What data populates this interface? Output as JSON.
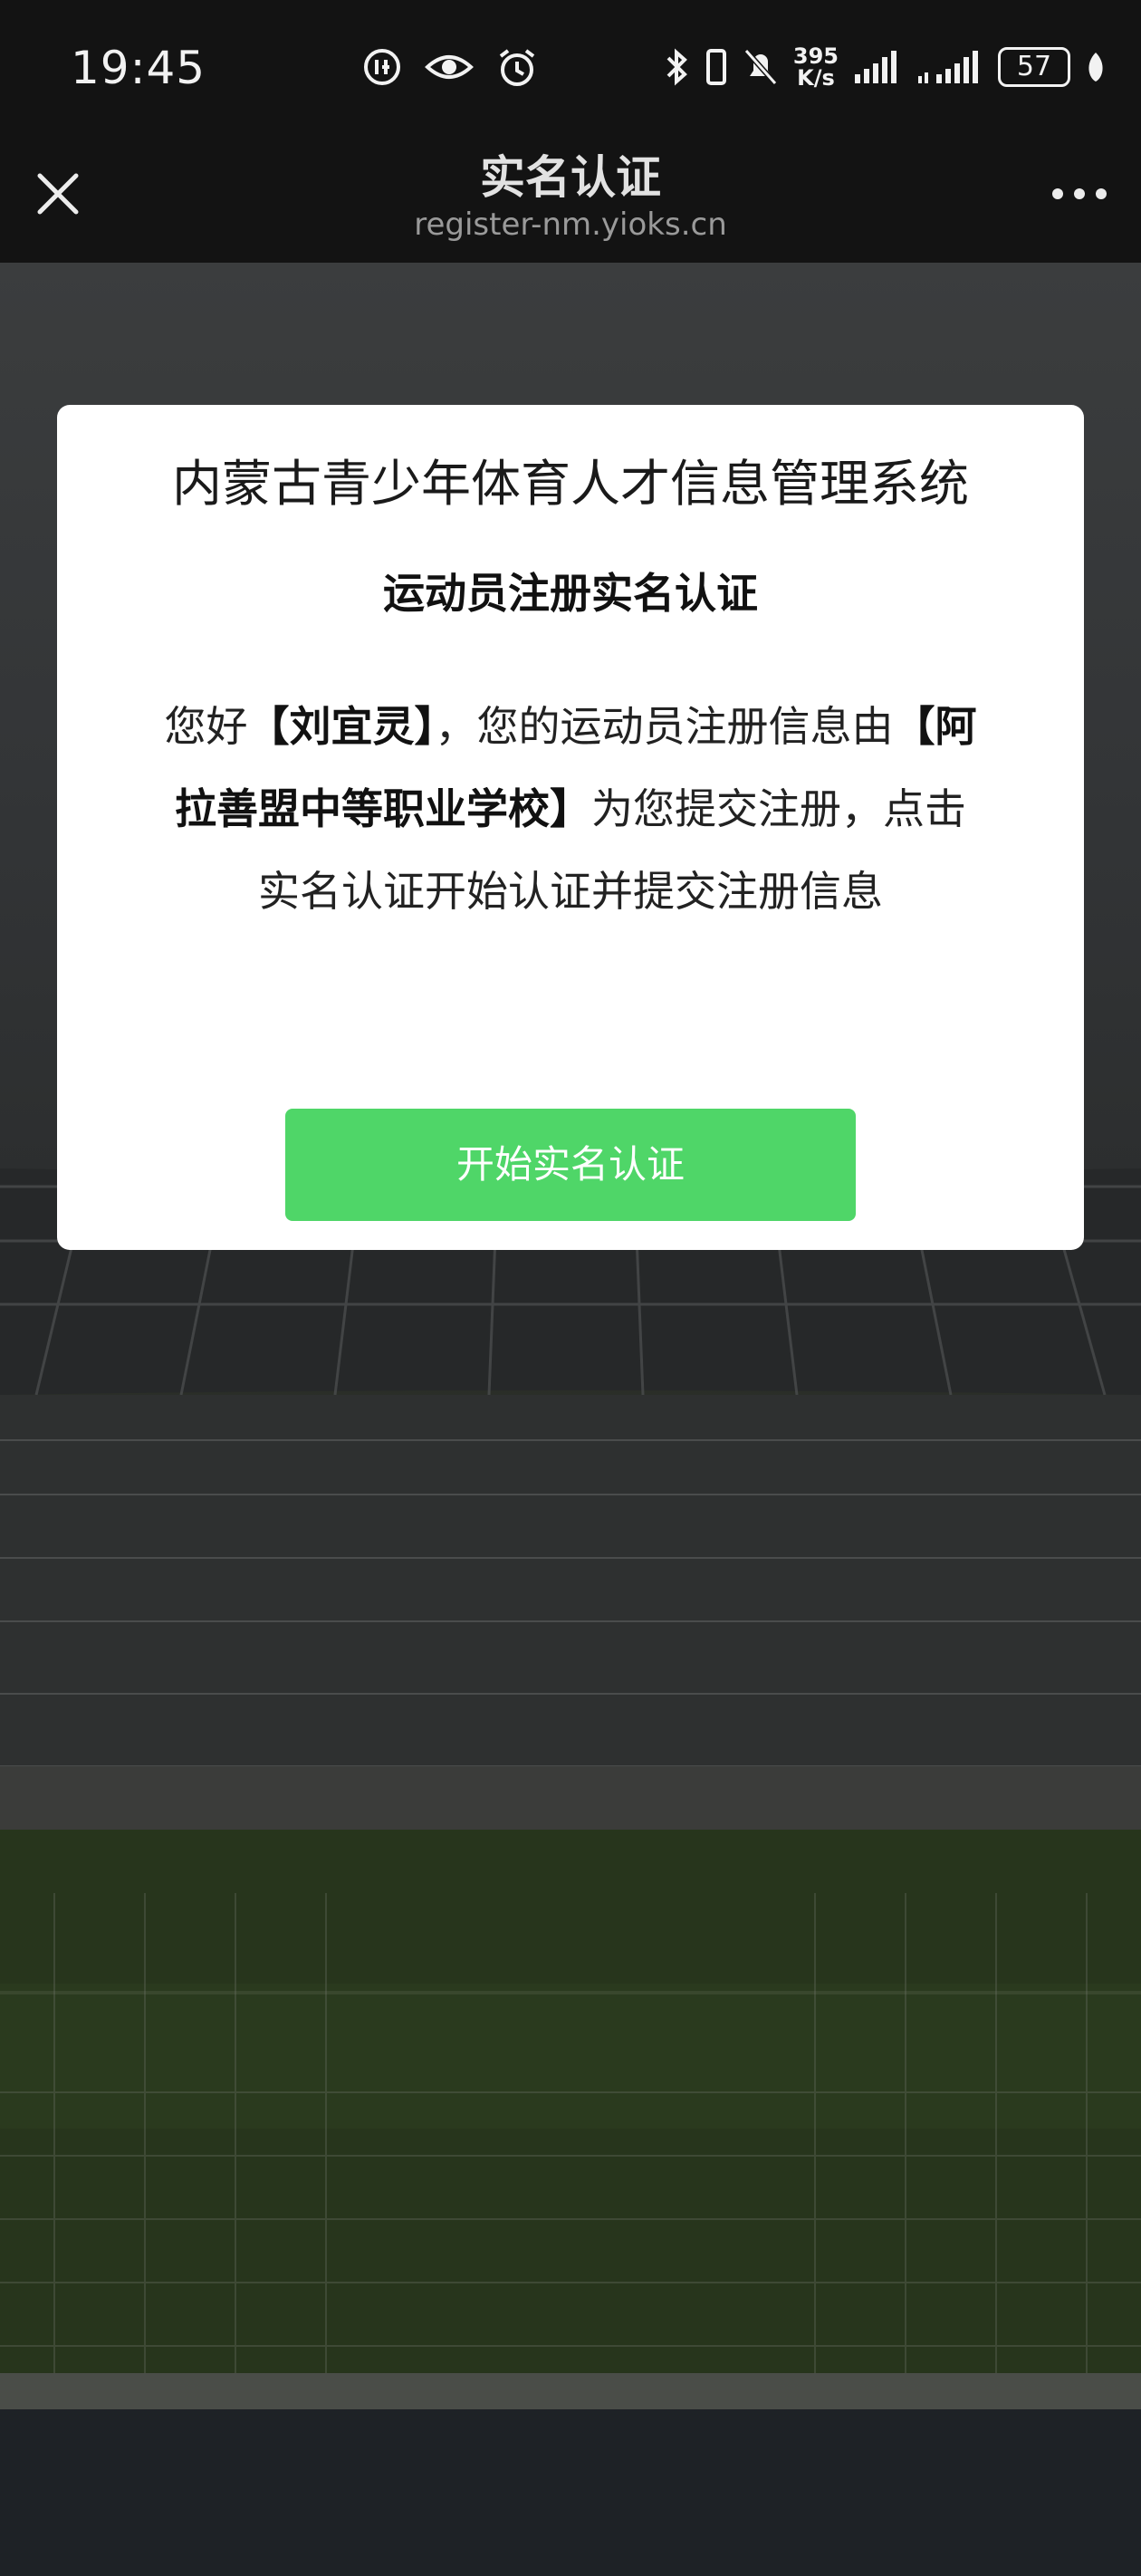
{
  "status_bar": {
    "time": "19:45",
    "net_speed_value": "395",
    "net_speed_unit": "K/s",
    "battery": "57",
    "icons": [
      "hd-icon",
      "eye-icon",
      "alarm-icon",
      "bluetooth-icon",
      "vibrate-icon",
      "mute-icon",
      "signal-icon",
      "signal-icon-2",
      "leaf-icon"
    ]
  },
  "nav": {
    "title": "实名认证",
    "url": "register-nm.yioks.cn",
    "close_icon": "close-icon",
    "more_icon": "more-icon"
  },
  "modal": {
    "system_name": "内蒙古青少年体育人才信息管理系统",
    "heading": "运动员注册实名认证",
    "greeting": "您好",
    "athlete_name": "【刘宜灵】",
    "msg_1": "，您的运动员注册信息由",
    "school": "【阿拉善盟中等职业学校】",
    "msg_2": "为您提交注册，点击实名认证开始认证并提交注册信息",
    "button_label": "开始实名认证"
  },
  "colors": {
    "bar_bg": "#131313",
    "button": "#4fd668",
    "modal_bg": "#ffffff"
  }
}
